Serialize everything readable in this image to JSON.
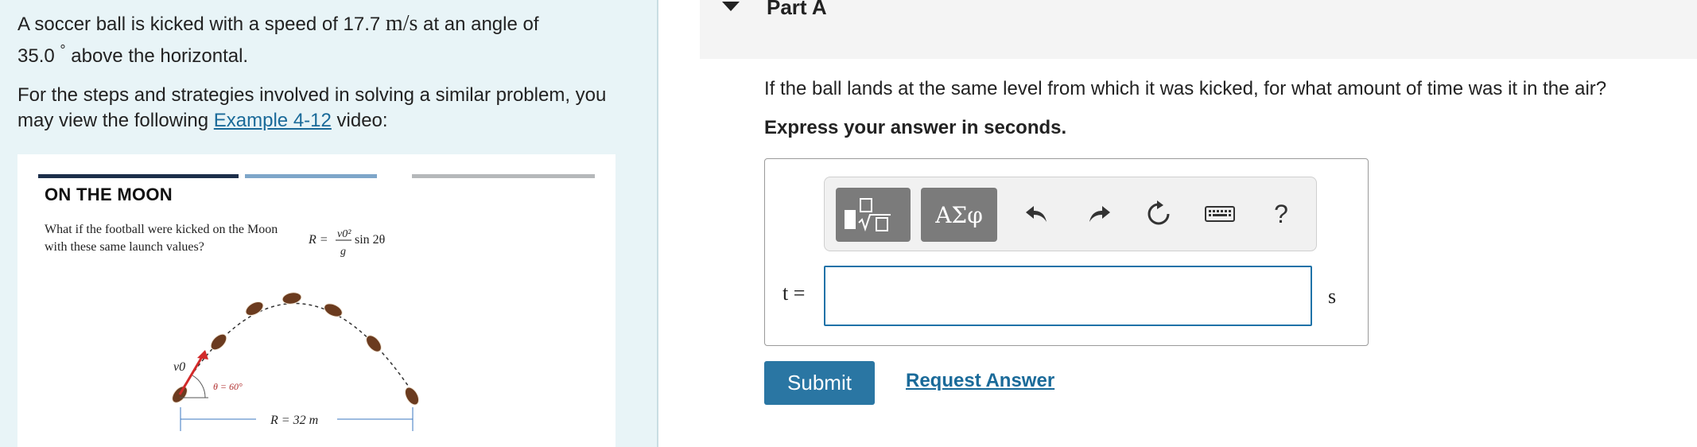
{
  "problem": {
    "p1_before": "A soccer ball is kicked with a speed of 17.7 ",
    "p1_unit": "m/s",
    "p1_after": " at an angle of",
    "p1_line2_value": "35.0",
    "p1_degree": "°",
    "p1_line2_after": " above the horizontal.",
    "p2_before": "For the steps and strategies involved in solving a similar problem, you may view the following ",
    "p2_link": "Example 4-12",
    "p2_after": " video:"
  },
  "figure": {
    "title": "ON THE MOON",
    "question": "What if the football were kicked on the Moon with these same launch values?",
    "formula_lhs": "R =",
    "formula_num": "v0²",
    "formula_den": "g",
    "formula_rhs": "sin 2θ",
    "v0_label": "v0",
    "angle_label": "θ = 60°",
    "range_label": "R = 32 m",
    "colors": {
      "bar1": "#1c2e4a",
      "bar2": "#7ea6c9",
      "bar3": "#b5b8ba",
      "ball": "#6b3b1f",
      "arrow": "#d22a2a",
      "dim": "#3b77c2"
    }
  },
  "part": {
    "title": "Part A"
  },
  "question": {
    "text": "If the ball lands at the same level from which it was kicked, for what amount of time was it in the air?",
    "instruction": "Express your answer in seconds."
  },
  "toolbar": {
    "templates_icon": "templates-icon",
    "greek_label": "ΑΣφ",
    "undo_icon": "undo-icon",
    "redo_icon": "redo-icon",
    "reset_icon": "reset-icon",
    "keyboard_icon": "keyboard-icon",
    "help_label": "?"
  },
  "answer": {
    "variable": "t =",
    "value": "",
    "unit": "s"
  },
  "actions": {
    "submit_label": "Submit",
    "request_label": "Request Answer"
  }
}
